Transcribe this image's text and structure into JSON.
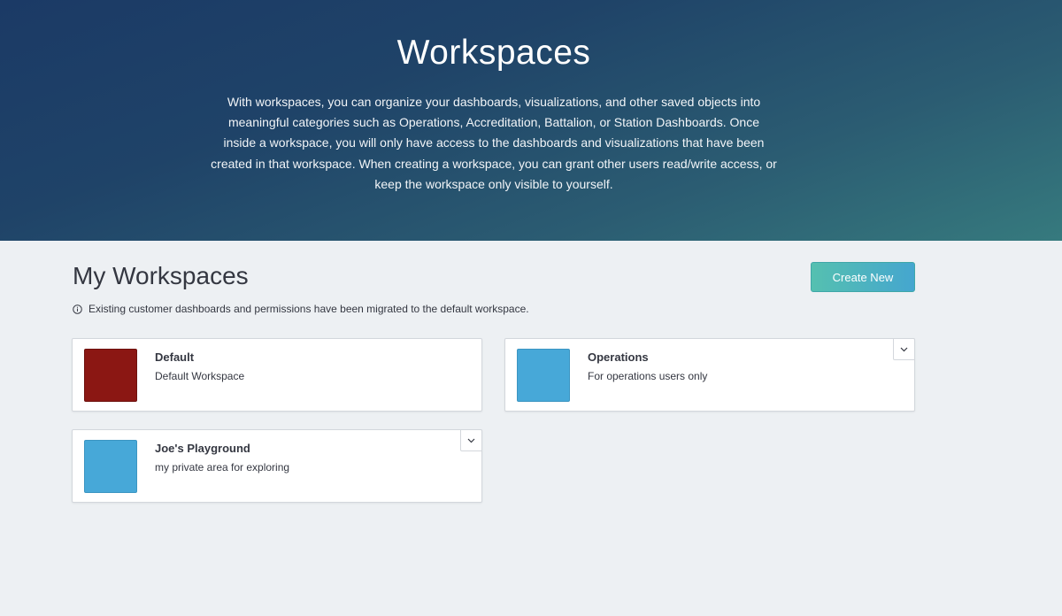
{
  "hero": {
    "title": "Workspaces",
    "description": "With workspaces, you can organize your dashboards, visualizations, and other saved objects into meaningful categories such as Operations, Accreditation, Battalion, or Station Dashboards. Once inside a workspace, you will only have access to the dashboards and visualizations that have been created in that workspace. When creating a workspace, you can grant other users read/write access, or keep the workspace only visible to yourself."
  },
  "section": {
    "title": "My Workspaces",
    "create_label": "Create New",
    "notice": "Existing customer dashboards and permissions have been migrated to the default workspace."
  },
  "workspaces": [
    {
      "name": "Default",
      "description": "Default Workspace",
      "color": "#8b1713",
      "has_menu": false
    },
    {
      "name": "Operations",
      "description": "For operations users only",
      "color": "#47a8d8",
      "has_menu": true
    },
    {
      "name": "Joe's Playground",
      "description": "my private area for exploring",
      "color": "#47a8d8",
      "has_menu": true
    }
  ],
  "icons": {
    "info": "info-circle-icon",
    "menu": "chevron-down-icon"
  }
}
